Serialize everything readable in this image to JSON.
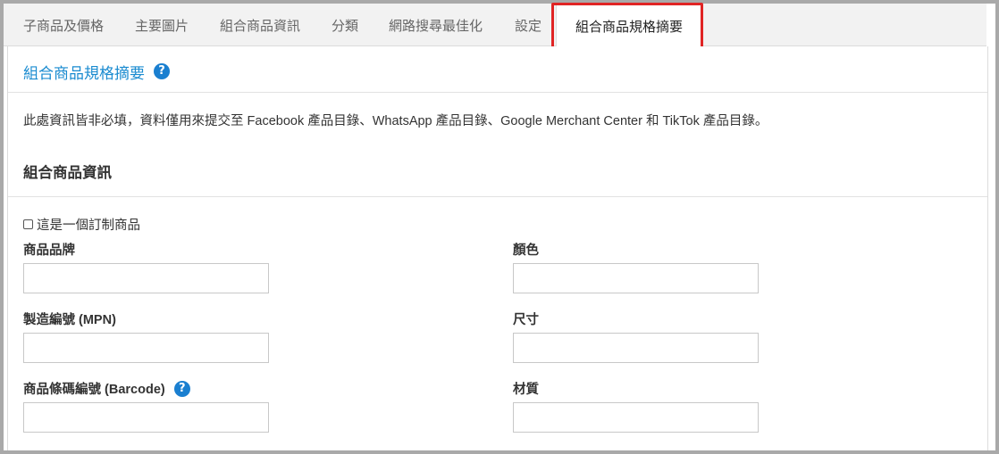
{
  "tabs": [
    {
      "label": "子商品及價格",
      "active": false
    },
    {
      "label": "主要圖片",
      "active": false
    },
    {
      "label": "組合商品資訊",
      "active": false
    },
    {
      "label": "分類",
      "active": false
    },
    {
      "label": "網路搜尋最佳化",
      "active": false
    },
    {
      "label": "設定",
      "active": false
    },
    {
      "label": "組合商品規格摘要",
      "active": true
    }
  ],
  "section": {
    "title": "組合商品規格摘要",
    "help_glyph": "?",
    "description": "此處資訊皆非必填，資料僅用來提交至 Facebook 產品目錄、WhatsApp 產品目錄、Google Merchant Center 和 TikTok 產品目錄。",
    "subheading": "組合商品資訊"
  },
  "form": {
    "custom_checkbox_label": "這是一個訂制商品",
    "custom_checked": false,
    "brand": {
      "label": "商品品牌",
      "value": ""
    },
    "color": {
      "label": "顏色",
      "value": ""
    },
    "mpn": {
      "label": "製造編號 (MPN)",
      "value": ""
    },
    "size": {
      "label": "尺寸",
      "value": ""
    },
    "barcode": {
      "label": "商品條碼編號 (Barcode)",
      "value": "",
      "help_glyph": "?"
    },
    "material": {
      "label": "材質",
      "value": ""
    }
  },
  "colors": {
    "accent": "#1a8bd0",
    "highlight": "#e02424",
    "tab_bg": "#f2f2f2"
  }
}
